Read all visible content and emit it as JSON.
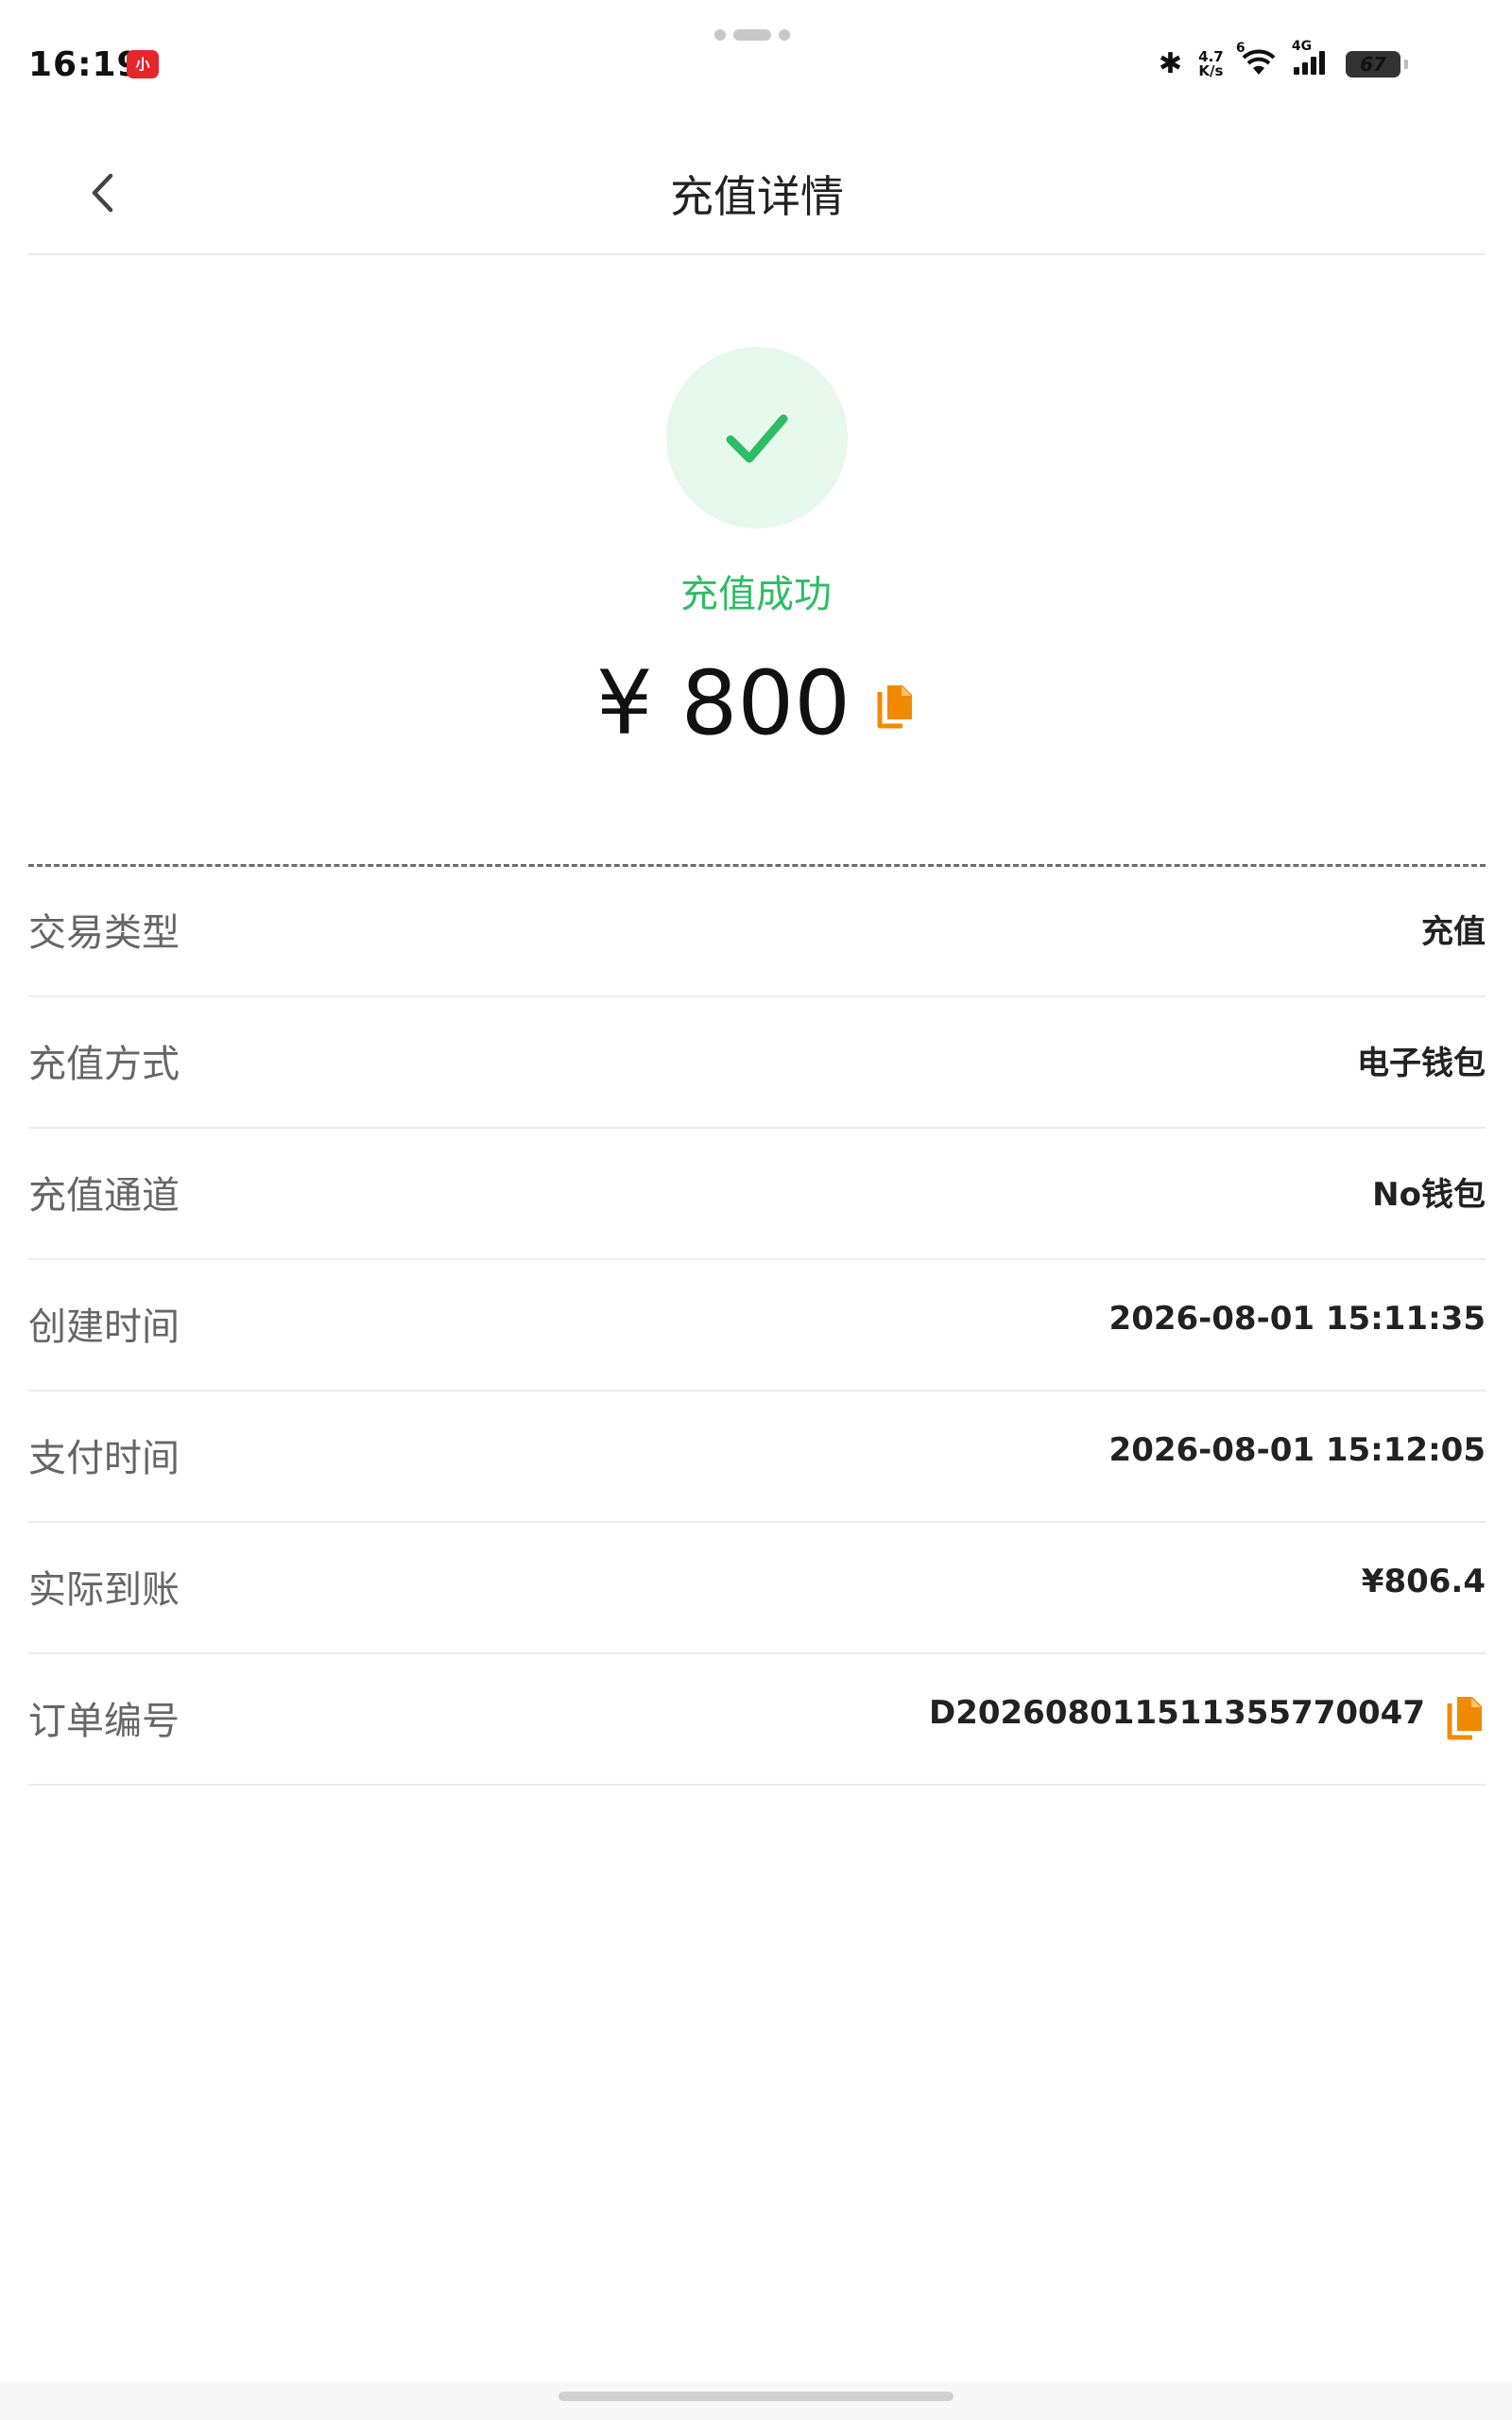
{
  "status_bar": {
    "time": "16:19",
    "app_badge": "小",
    "bluetooth_glyph": "✱",
    "net_speed_value": "4.7",
    "net_speed_unit": "K/s",
    "wifi_label": "6",
    "network_label": "4G",
    "battery": "67"
  },
  "header": {
    "title": "充值详情"
  },
  "summary": {
    "status_text": "充值成功",
    "amount": "¥ 800",
    "status_color": "#2dbd63",
    "copy_icon_color": "#f08a00"
  },
  "details": {
    "rows": [
      {
        "label": "交易类型",
        "value": "充值"
      },
      {
        "label": "充值方式",
        "value": "电子钱包"
      },
      {
        "label": "充值通道",
        "value": "No钱包"
      },
      {
        "label": "创建时间",
        "value": "2026-08-01 15:11:35"
      },
      {
        "label": "支付时间",
        "value": "2026-08-01 15:12:05"
      },
      {
        "label": "实际到账",
        "value": "¥806.4"
      },
      {
        "label": "订单编号",
        "value": "D202608011511355770047"
      }
    ]
  },
  "icons": {
    "back": "chevron-left-icon",
    "success": "checkmark-icon",
    "copy": "copy-icon"
  }
}
